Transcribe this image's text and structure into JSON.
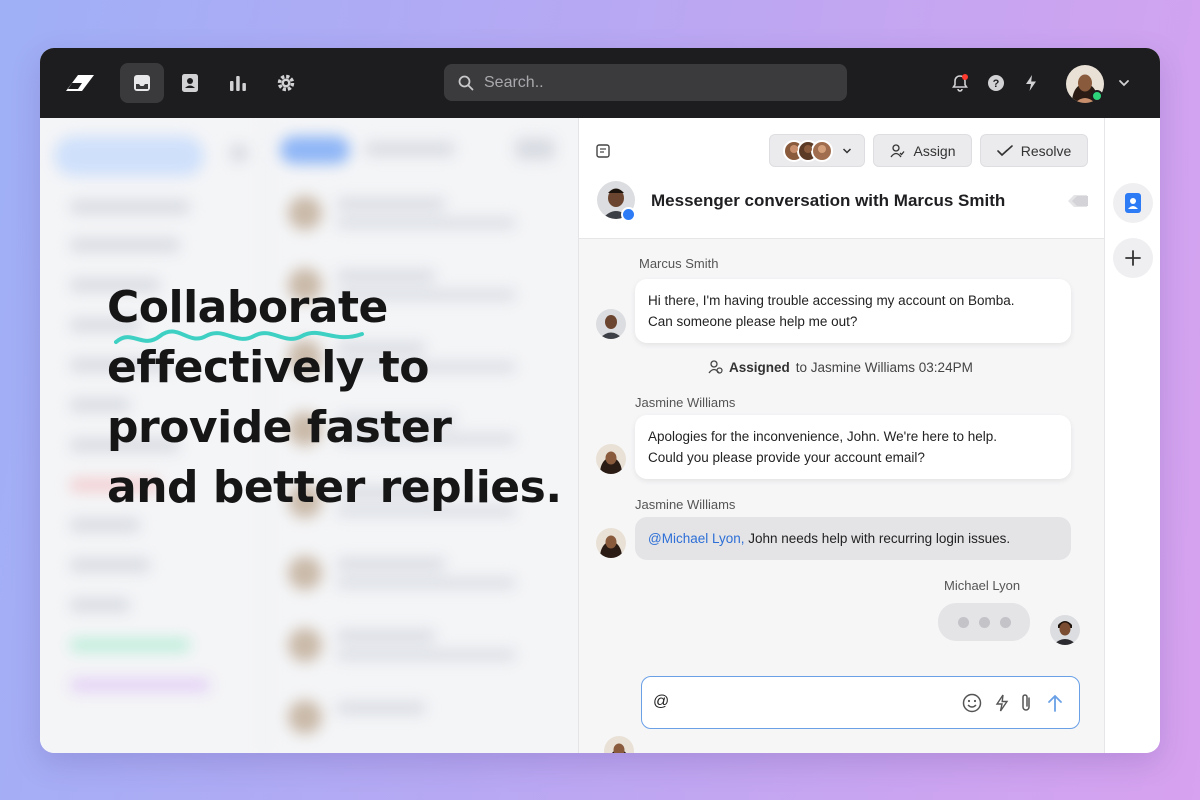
{
  "topbar": {
    "search_placeholder": "Search..",
    "nav_icons": [
      "inbox-icon",
      "contacts-icon",
      "reports-icon",
      "settings-icon"
    ],
    "right_icons": [
      "bell-icon",
      "help-icon",
      "lightning-icon"
    ]
  },
  "hero": {
    "lines": [
      "Collaborate",
      "effectively to",
      "provide faster",
      "and better replies."
    ]
  },
  "conversation": {
    "assign_label": "Assign",
    "resolve_label": "Resolve",
    "title": "Messenger conversation with Marcus Smith",
    "messages": [
      {
        "sender": "Marcus Smith",
        "text_1": "Hi there, I'm having trouble accessing my account on Bomba.",
        "text_2": "Can someone please help me out?"
      },
      {
        "sender": "Jasmine Williams",
        "text_1": "Apologies for the inconvenience, John. We're here to help.",
        "text_2": "Could you please provide your account email?"
      },
      {
        "sender": "Jasmine Williams",
        "mention": "@Michael Lyon,",
        "text": " John needs help with recurring login issues."
      }
    ],
    "event": {
      "bold": "Assigned",
      "rest": "to Jasmine Williams 03:24PM"
    },
    "typing_sender": "Michael Lyon",
    "composer_value": "@"
  },
  "colors": {
    "accent": "#2d6fd6",
    "online": "#2ed47a",
    "topbar": "#1d1d1f"
  }
}
